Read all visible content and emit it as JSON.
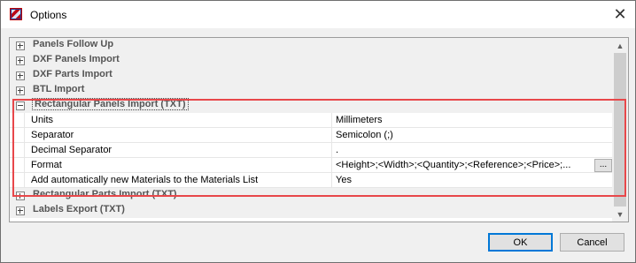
{
  "window": {
    "title": "Options"
  },
  "grid": {
    "categories_top": [
      {
        "label": "Panels Follow Up"
      },
      {
        "label": "DXF Panels Import"
      },
      {
        "label": "DXF Parts Import"
      },
      {
        "label": "BTL Import"
      }
    ],
    "expanded_category": {
      "label": "Rectangular Panels Import (TXT)",
      "properties": [
        {
          "name": "Units",
          "value": "Millimeters"
        },
        {
          "name": "Separator",
          "value": "Semicolon (;)"
        },
        {
          "name": "Decimal Separator",
          "value": "."
        },
        {
          "name": "Format",
          "value": "<Height>;<Width>;<Quantity>;<Reference>;<Price>;...",
          "button": "..."
        },
        {
          "name": "Add automatically new Materials to the Materials List",
          "value": "Yes"
        }
      ]
    },
    "categories_bottom": [
      {
        "label": "Rectangular Parts Import (TXT)"
      },
      {
        "label": "Labels Export (TXT)"
      }
    ]
  },
  "buttons": {
    "ok": "OK",
    "cancel": "Cancel"
  },
  "icons": {
    "close": "close-icon",
    "app": "app-logo-icon"
  },
  "colors": {
    "highlight": "#e8474a",
    "default_button_border": "#0078d7"
  }
}
